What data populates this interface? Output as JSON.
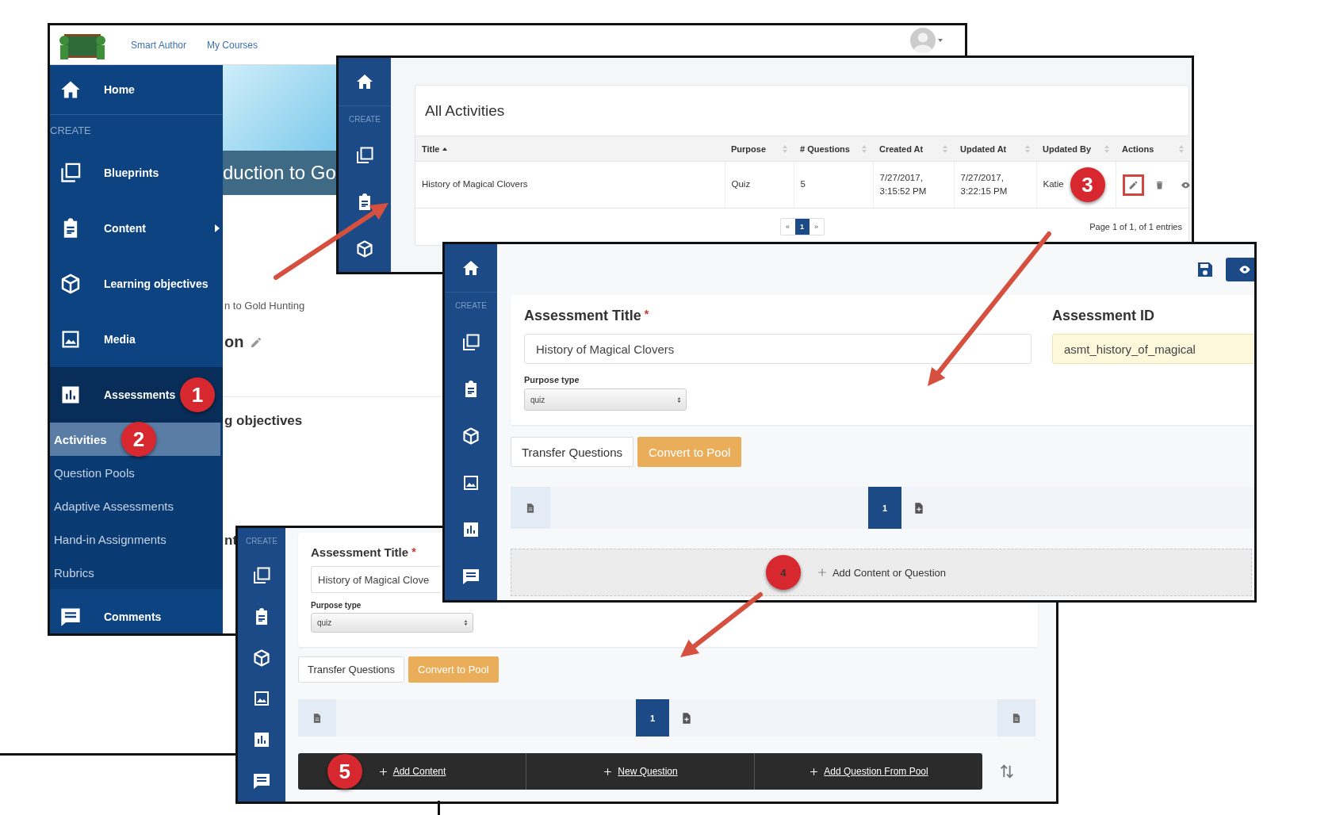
{
  "base_window": {
    "top_bar": {
      "links": [
        "Smart Author",
        "My Courses"
      ]
    },
    "sidebar": {
      "home": {
        "label": "Home"
      },
      "section_label": "CREATE",
      "items": [
        {
          "label": "Blueprints",
          "selected": false,
          "expandable": false
        },
        {
          "label": "Content",
          "selected": false,
          "expandable": true
        },
        {
          "label": "Learning objectives",
          "selected": false,
          "expandable": false
        },
        {
          "label": "Media",
          "selected": false,
          "expandable": false
        },
        {
          "label": "Assessments",
          "selected": true,
          "expandable": false,
          "callout": "1"
        }
      ],
      "submenu": [
        {
          "label": "Activities",
          "selected": true,
          "callout": "2"
        },
        {
          "label": "Question Pools",
          "selected": false
        },
        {
          "label": "Adaptive Assessments",
          "selected": false
        },
        {
          "label": "Hand-in Assignments",
          "selected": false
        },
        {
          "label": "Rubrics",
          "selected": false
        }
      ],
      "footer_item": {
        "label": "Comments"
      }
    },
    "banner": {
      "title": "duction to Go"
    },
    "content_fragments": [
      {
        "kind": "subtitle",
        "text": "n to Gold Hunting",
        "editable": false
      },
      {
        "kind": "heading",
        "text": "on",
        "editable": true
      },
      {
        "kind": "section",
        "text": "g objectives",
        "editable": false
      },
      {
        "kind": "section",
        "text": "nt",
        "editable": false
      }
    ]
  },
  "activities_window": {
    "sidebar": {
      "section_label": "CREATE"
    },
    "card": {
      "title": "All Activities",
      "columns": [
        {
          "label": "Title",
          "sorted": true
        },
        {
          "label": "Purpose",
          "sorted": false
        },
        {
          "label": "# Questions",
          "sorted": false
        },
        {
          "label": "Created At",
          "sorted": false
        },
        {
          "label": "Updated At",
          "sorted": false
        },
        {
          "label": "Updated By",
          "sorted": false
        },
        {
          "label": "Actions",
          "sorted": false
        }
      ],
      "rows": [
        {
          "cells": [
            "History of Magical Clovers",
            "Quiz",
            "5",
            "7/27/2017, 3:15:52 PM",
            "7/27/2017, 3:22:15 PM",
            "Katie"
          ],
          "callout": "3",
          "actions": [
            {
              "kind": "edit",
              "highlighted": true
            },
            {
              "kind": "delete",
              "highlighted": false
            },
            {
              "kind": "view",
              "highlighted": false
            }
          ]
        }
      ],
      "pagination": {
        "prev": "«",
        "pages": [
          {
            "label": "1",
            "selected": true
          }
        ],
        "next": "»",
        "summary": "Page 1 of 1, of 1 entries"
      }
    }
  },
  "editor_window": {
    "sidebar": {
      "section_label": "CREATE"
    },
    "form": {
      "title_field": {
        "label": "Assessment Title",
        "required_mark": "*",
        "value": "History of Magical Clovers"
      },
      "id_field": {
        "label": "Assessment ID",
        "value": "asmt_history_of_magical"
      },
      "purpose_field": {
        "label": "Purpose type",
        "value": "quiz"
      }
    },
    "buttons": [
      {
        "label": "Transfer Questions",
        "kind": "default"
      },
      {
        "label": "Convert to Pool",
        "kind": "warning"
      }
    ],
    "page_nav": {
      "pages": [
        {
          "label": "1",
          "selected": true
        }
      ]
    },
    "add_area": {
      "label": "Add Content or Question",
      "callout": "4"
    }
  },
  "editor_window_lower": {
    "sidebar": {
      "section_label": "CREATE"
    },
    "form": {
      "title_field": {
        "label": "Assessment Title",
        "required_mark": "*",
        "value": "History of Magical Clove"
      },
      "purpose_field": {
        "label": "Purpose type",
        "value": "quiz"
      }
    },
    "buttons": [
      {
        "label": "Transfer Questions",
        "kind": "default"
      },
      {
        "label": "Convert to Pool",
        "kind": "warning"
      }
    ],
    "page_nav": {
      "pages": [
        {
          "label": "1",
          "selected": true
        }
      ]
    },
    "toolbar": [
      {
        "label": "Add Content",
        "callout": "5"
      },
      {
        "label": "New Question"
      },
      {
        "label": "Add Question From Pool"
      }
    ]
  }
}
